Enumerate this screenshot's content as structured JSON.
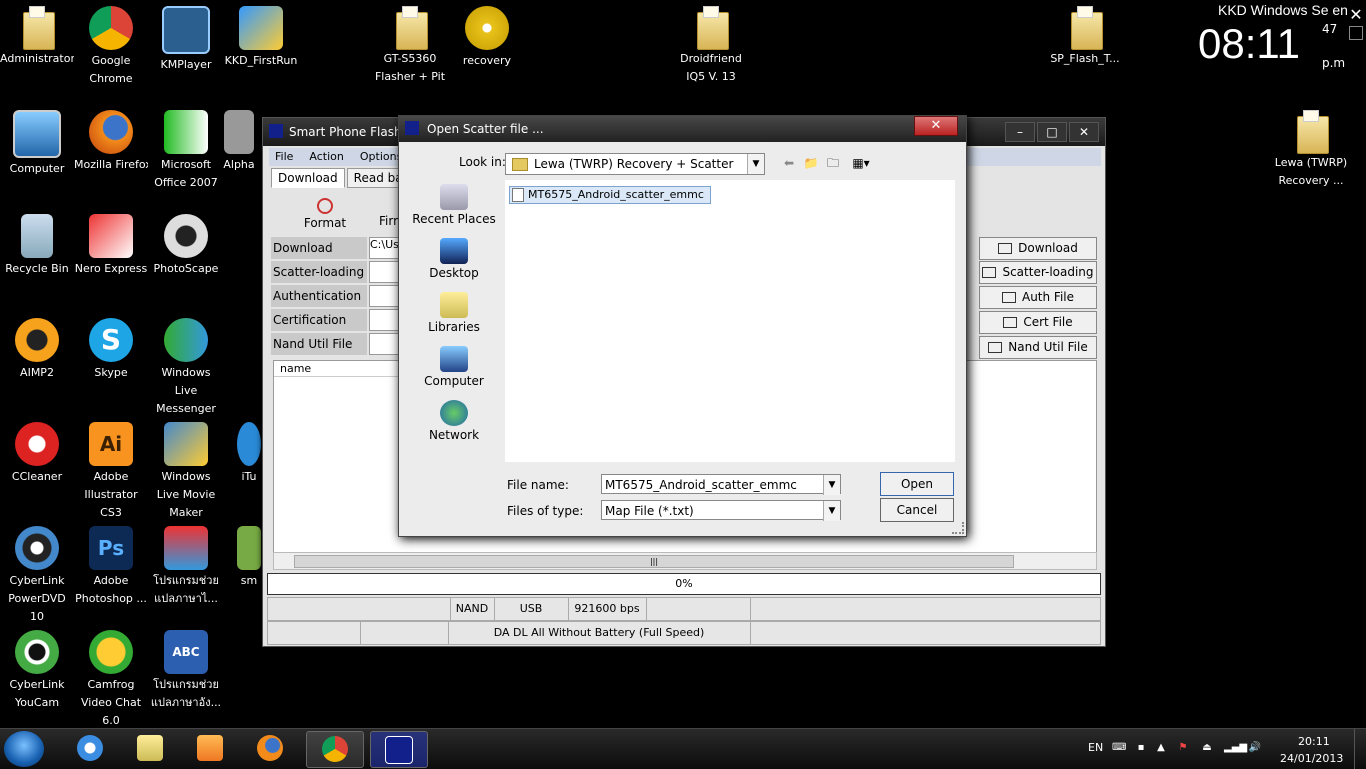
{
  "desktop": {
    "icons": [
      {
        "label": "Administrator"
      },
      {
        "label": "Google Chrome"
      },
      {
        "label": "KMPlayer"
      },
      {
        "label": "KKD_FirstRun"
      },
      {
        "label": "GT-S5360 Flasher + Pit"
      },
      {
        "label": "recovery"
      },
      {
        "label": "Droidfriend IQ5 V. 13"
      },
      {
        "label": "SP_Flash_T..."
      },
      {
        "label": "Computer"
      },
      {
        "label": "Mozilla Firefox"
      },
      {
        "label": "Microsoft Office 2007"
      },
      {
        "label": "Alpha"
      },
      {
        "label": "Lewa (TWRP) Recovery ..."
      },
      {
        "label": "Recycle Bin"
      },
      {
        "label": "Nero Express"
      },
      {
        "label": "PhotoScape"
      },
      {
        "label": "AIMP2"
      },
      {
        "label": "Skype"
      },
      {
        "label": "Windows Live Messenger"
      },
      {
        "label": "CCleaner"
      },
      {
        "label": "Adobe Illustrator CS3"
      },
      {
        "label": "Windows Live Movie Maker"
      },
      {
        "label": "iTu"
      },
      {
        "label": "CyberLink PowerDVD 10"
      },
      {
        "label": "Adobe Photoshop ..."
      },
      {
        "label": "โปรแกรมช่วยแปลภาษาไ..."
      },
      {
        "label": "sm"
      },
      {
        "label": "CyberLink YouCam"
      },
      {
        "label": "Camfrog Video Chat 6.0"
      },
      {
        "label": "โปรแกรมช่วยแปลภาษาอัง..."
      }
    ]
  },
  "gadget": {
    "title": "KKD Windows Se  en",
    "time": "08:11",
    "seconds": "47",
    "ampm": "p.m"
  },
  "app": {
    "title": "Smart Phone Flash To",
    "menu": [
      "File",
      "Action",
      "Options"
    ],
    "tabs": [
      "Download",
      "Read back"
    ],
    "tools": {
      "format": "Format",
      "firm": "Firm"
    },
    "fields": [
      {
        "label": "Download Agent",
        "value": "C:\\Us"
      },
      {
        "label": "Scatter-loading File",
        "value": ""
      },
      {
        "label": "Authentication File",
        "value": ""
      },
      {
        "label": "Certification File",
        "value": ""
      },
      {
        "label": "Nand Util File",
        "value": ""
      }
    ],
    "right_buttons": [
      "Download Agent",
      "Scatter-loading",
      "Auth File",
      "Cert File",
      "Nand Util File"
    ],
    "list_header": "name",
    "progress": "0%",
    "status": {
      "nand": "NAND",
      "usb": "USB",
      "baud": "921600 bps",
      "mode": "DA DL All Without Battery (Full Speed)"
    }
  },
  "dialog": {
    "title": "Open Scatter file ...",
    "look_in_label": "Look in:",
    "look_in_value": "Lewa (TWRP) Recovery + Scatter",
    "places": [
      "Recent Places",
      "Desktop",
      "Libraries",
      "Computer",
      "Network"
    ],
    "files": [
      "MT6575_Android_scatter_emmc"
    ],
    "file_name_label": "File name:",
    "file_name_value": "MT6575_Android_scatter_emmc",
    "file_type_label": "Files of type:",
    "file_type_value": "Map File (*.txt)",
    "open_label": "Open",
    "cancel_label": "Cancel"
  },
  "taskbar": {
    "lang": "EN",
    "time": "20:11",
    "date": "24/01/2013"
  }
}
